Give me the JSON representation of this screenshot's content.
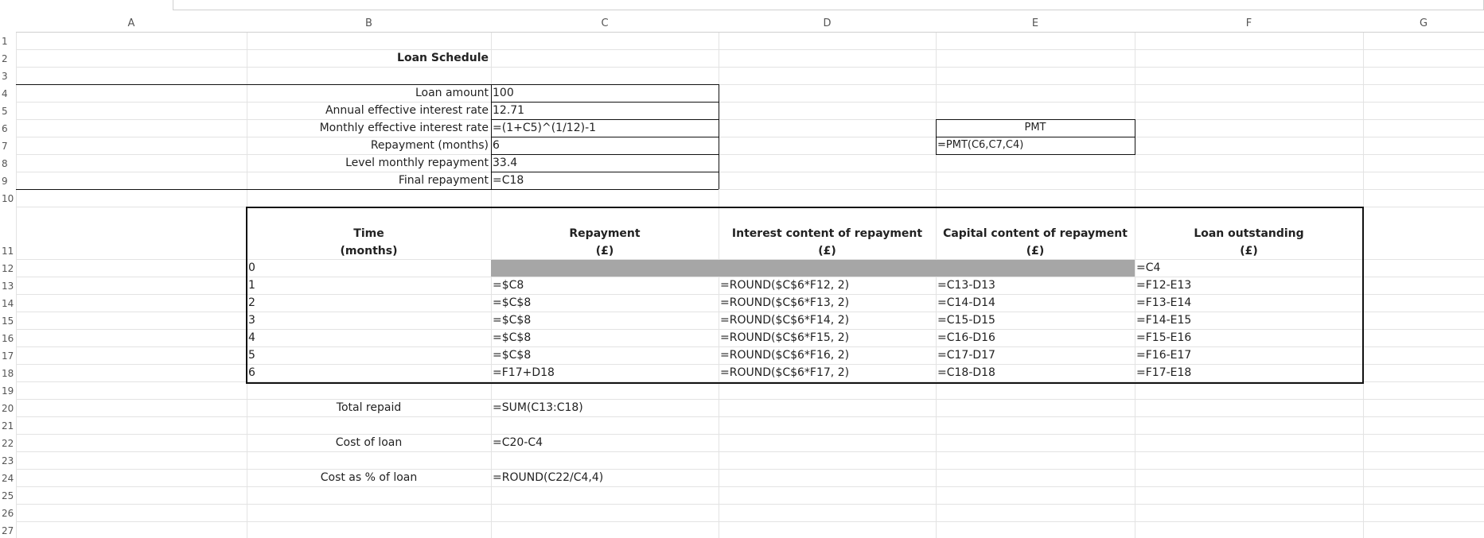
{
  "columns": [
    "A",
    "B",
    "C",
    "D",
    "E",
    "F",
    "G"
  ],
  "rows": [
    "1",
    "2",
    "3",
    "4",
    "5",
    "6",
    "7",
    "8",
    "9",
    "10",
    "11",
    "12",
    "13",
    "14",
    "15",
    "16",
    "17",
    "18",
    "19",
    "20",
    "21",
    "22",
    "23",
    "24",
    "25",
    "26",
    "27"
  ],
  "title": "Loan Schedule",
  "inputs": [
    {
      "label": "Loan amount",
      "value": "100"
    },
    {
      "label": "Annual effective interest rate",
      "value": "12.71"
    },
    {
      "label": "Monthly effective interest rate",
      "value": "=(1+C5)^(1/12)-1"
    },
    {
      "label": "Repayment (months)",
      "value": "6"
    },
    {
      "label": "Level monthly repayment",
      "value": "33.4"
    },
    {
      "label": "Final repayment",
      "value": "=C18"
    }
  ],
  "pmt": {
    "label": "PMT",
    "formula": "=PMT(C6,C7,C4)"
  },
  "schedule": {
    "headers": [
      {
        "line1": "Time",
        "line2": "(months)"
      },
      {
        "line1": "Repayment",
        "line2": "(£)"
      },
      {
        "line1": "Interest content of repayment",
        "line2": "(£)"
      },
      {
        "line1": "Capital content of repayment",
        "line2": "(£)"
      },
      {
        "line1": "Loan outstanding",
        "line2": "(£)"
      }
    ],
    "rows": [
      {
        "time": "0",
        "repayment": "",
        "interest": "",
        "capital": "",
        "outstanding": "=C4"
      },
      {
        "time": "1",
        "repayment": "=$C8",
        "interest": "=ROUND($C$6*F12, 2)",
        "capital": "=C13-D13",
        "outstanding": "=F12-E13"
      },
      {
        "time": "2",
        "repayment": "=$C$8",
        "interest": "=ROUND($C$6*F13, 2)",
        "capital": "=C14-D14",
        "outstanding": "=F13-E14"
      },
      {
        "time": "3",
        "repayment": "=$C$8",
        "interest": "=ROUND($C$6*F14, 2)",
        "capital": "=C15-D15",
        "outstanding": "=F14-E15"
      },
      {
        "time": "4",
        "repayment": "=$C$8",
        "interest": "=ROUND($C$6*F15, 2)",
        "capital": "=C16-D16",
        "outstanding": "=F15-E16"
      },
      {
        "time": "5",
        "repayment": "=$C$8",
        "interest": "=ROUND($C$6*F16, 2)",
        "capital": "=C17-D17",
        "outstanding": "=F16-E17"
      },
      {
        "time": "6",
        "repayment": "=F17+D18",
        "interest": "=ROUND($C$6*F17, 2)",
        "capital": "=C18-D18",
        "outstanding": "=F17-E18"
      }
    ]
  },
  "summary": [
    {
      "label": "Total repaid",
      "value": "=SUM(C13:C18)"
    },
    {
      "label": "Cost of loan",
      "value": "=C20-C4"
    },
    {
      "label": "Cost as % of loan",
      "value": "=ROUND(C22/C4,4)"
    }
  ],
  "colors": {
    "grid": "#e3e3e3",
    "shade": "#a6a6a6",
    "border": "#111111"
  }
}
